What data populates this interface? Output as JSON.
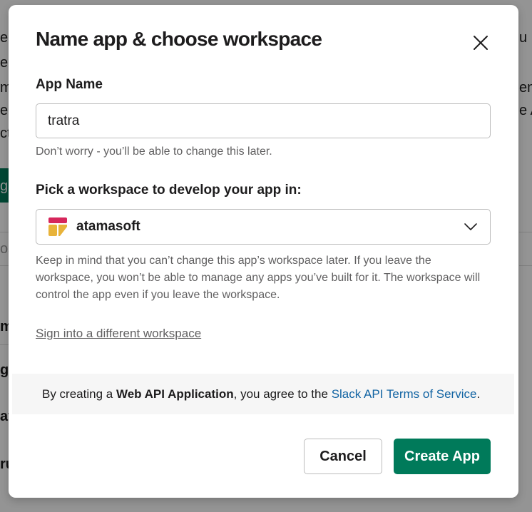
{
  "background": {
    "left_fragments": [
      "ee",
      "er",
      "m",
      "e",
      "ct",
      "g",
      "os",
      "m",
      "g",
      "at",
      "ru"
    ],
    "right_fragments": [
      "u",
      "ent",
      "e A"
    ]
  },
  "modal": {
    "title": "Name app & choose workspace",
    "close_icon": "close-icon",
    "app_name_label": "App Name",
    "app_name_value": "tratra",
    "app_name_hint": "Don’t worry - you’ll be able to change this later.",
    "workspace_label": "Pick a workspace to develop your app in:",
    "workspace_selected": "atamasoft",
    "workspace_hint": "Keep in mind that you can’t change this app’s workspace later. If you leave the workspace, you won’t be able to manage any apps you’ve built for it. The workspace will control the app even if you leave the workspace.",
    "sign_in_link": "Sign into a different workspace",
    "terms": {
      "prefix": "By creating a ",
      "bold": "Web API Application",
      "middle": ", you agree to the ",
      "link": "Slack API Terms of Service",
      "suffix": "."
    },
    "cancel_label": "Cancel",
    "create_label": "Create App"
  },
  "colors": {
    "primary": "#007a5a",
    "link": "#1264a3",
    "text": "#1d1c1d",
    "muted": "#616061"
  }
}
